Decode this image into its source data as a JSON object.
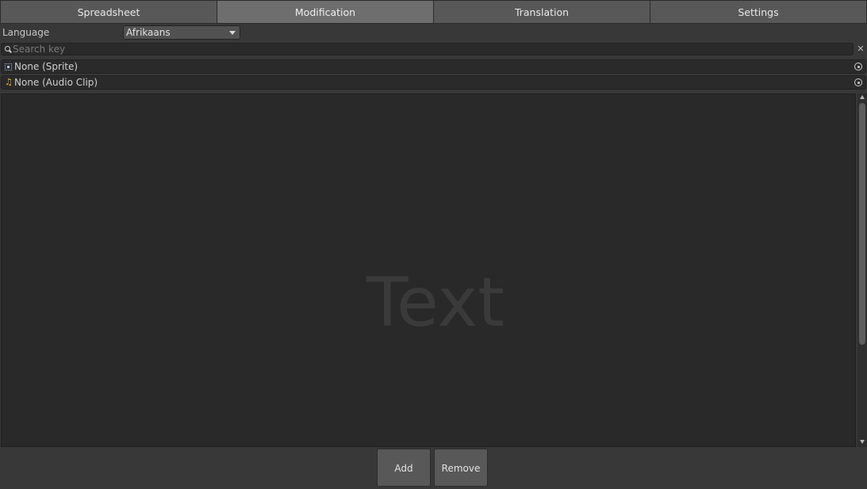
{
  "tabs": [
    {
      "label": "Spreadsheet",
      "active": false
    },
    {
      "label": "Modification",
      "active": true
    },
    {
      "label": "Translation",
      "active": false
    },
    {
      "label": "Settings",
      "active": false
    }
  ],
  "language": {
    "label": "Language",
    "selected": "Afrikaans"
  },
  "search": {
    "placeholder": "Search key",
    "clear_icon": "close-icon"
  },
  "fields": {
    "sprite": {
      "label": "None (Sprite)",
      "icon": "sprite-icon"
    },
    "audio": {
      "label": "None (Audio Clip)",
      "icon": "audio-clip-icon"
    }
  },
  "editor": {
    "placeholder": "Text"
  },
  "buttons": {
    "add": "Add",
    "remove": "Remove"
  },
  "colors": {
    "background": "#383838",
    "field_background": "#2a2a2a",
    "active_tab": "#6e6e6e",
    "tab": "#585858",
    "audio_icon": "#e8b93a"
  }
}
